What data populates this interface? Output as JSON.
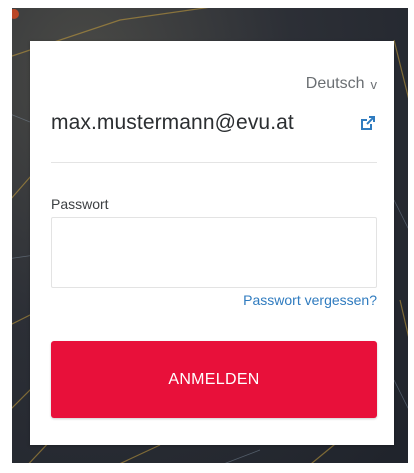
{
  "language": {
    "label": "Deutsch",
    "chevron": "v"
  },
  "account": {
    "email": "max.mustermann@evu.at"
  },
  "icons": {
    "edit": "edit-external-icon",
    "language_chevron": "chevron-down-icon"
  },
  "password": {
    "label": "Passwort",
    "value": "",
    "placeholder": ""
  },
  "forgot_link": "Passwort vergessen?",
  "login_button": "ANMELDEN",
  "colors": {
    "accent": "#e8103a",
    "link": "#2f7bbf",
    "text": "#2b2e31"
  }
}
